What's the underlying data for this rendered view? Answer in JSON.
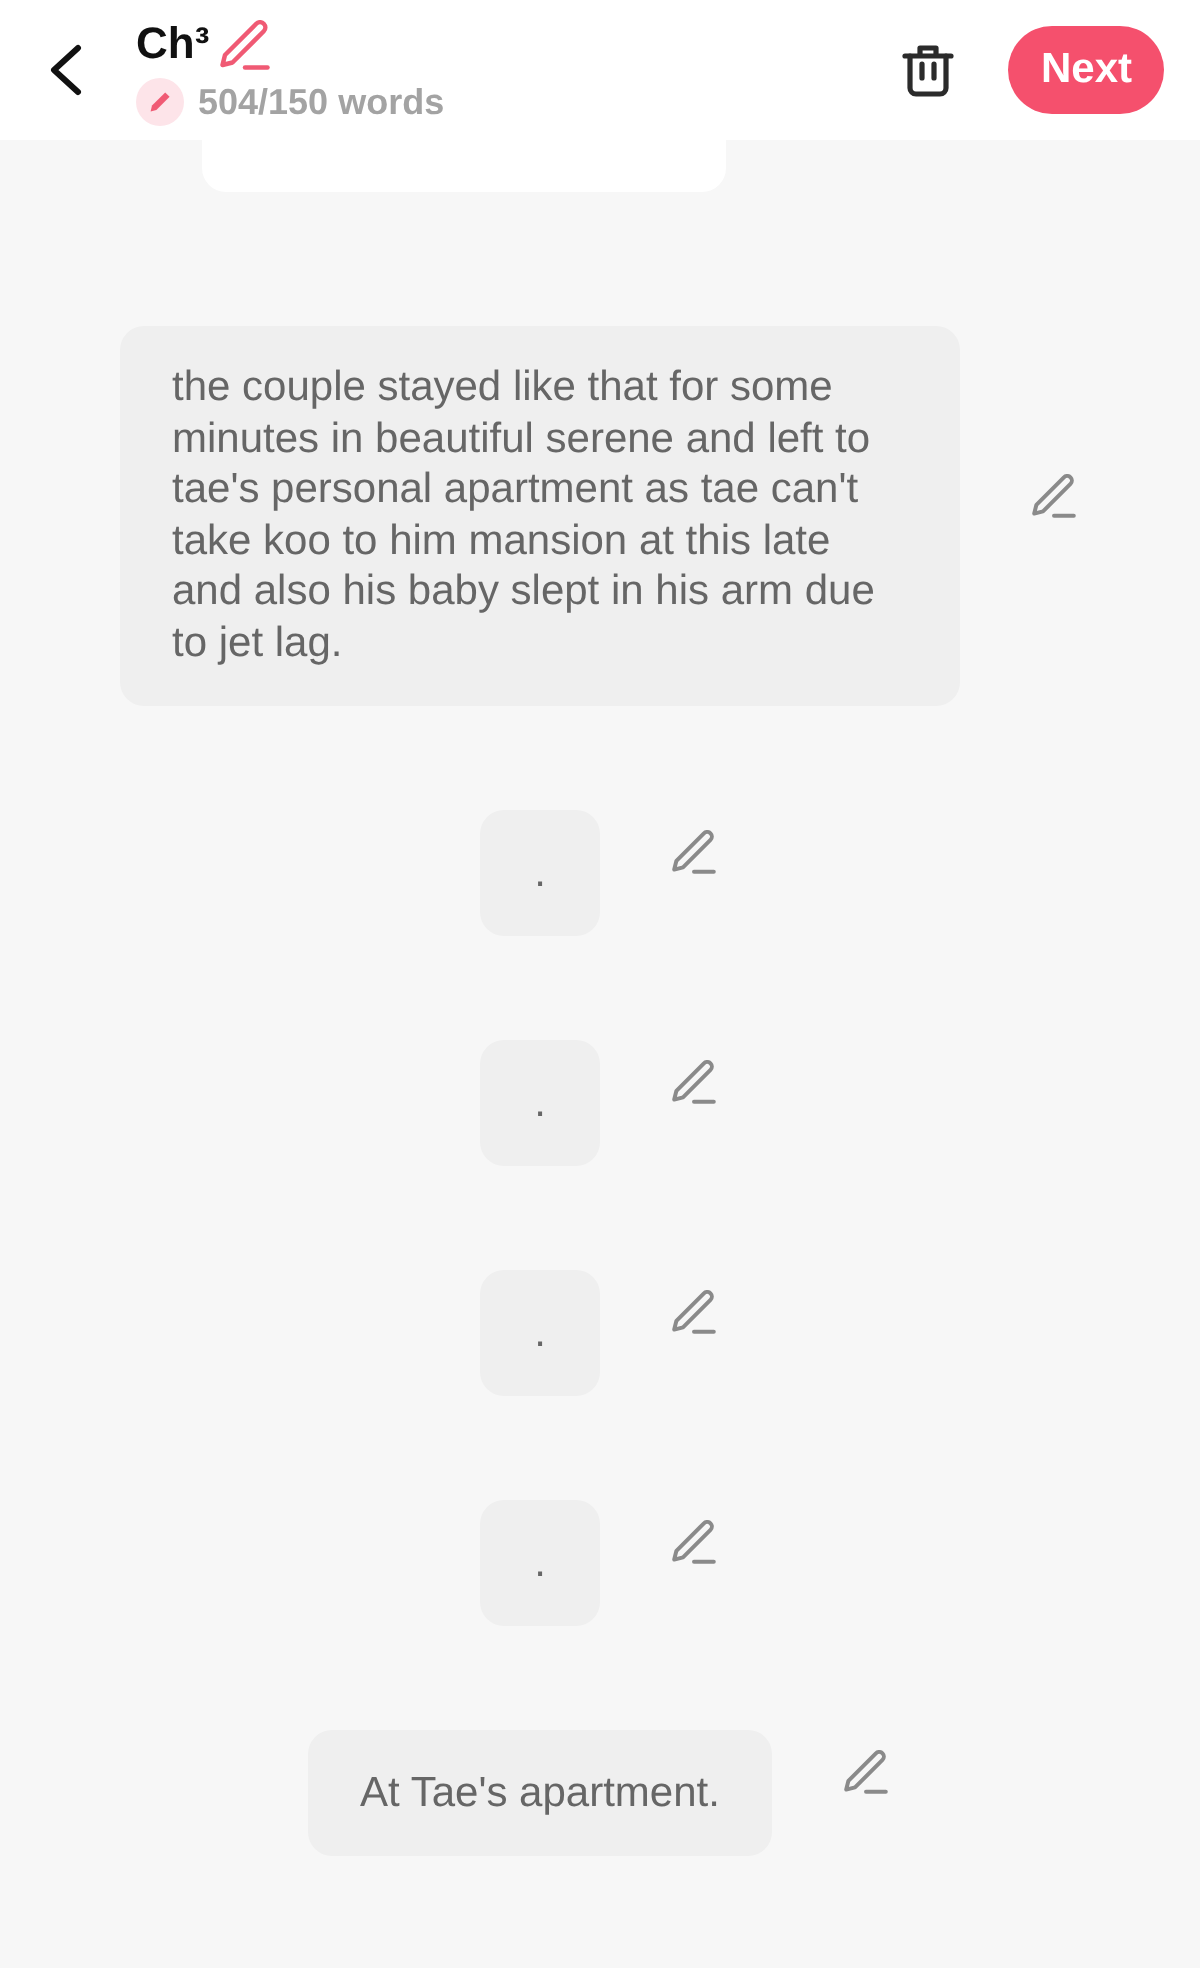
{
  "header": {
    "title": "Ch³",
    "word_count": "504/150 words",
    "next_button": "Next"
  },
  "blocks": [
    {
      "selected": true
    },
    {
      "text": "the couple stayed like that for some minutes in beautiful serene and left to tae's personal apartment as tae can't take koo to him mansion at this late and also his baby slept in his arm due to jet lag.",
      "selected": false
    },
    {
      "text": ".",
      "selected": false
    },
    {
      "text": ".",
      "selected": false
    },
    {
      "text": ".",
      "selected": false
    },
    {
      "text": ".",
      "selected": false
    },
    {
      "text": "At Tae's apartment.",
      "selected": false
    }
  ]
}
